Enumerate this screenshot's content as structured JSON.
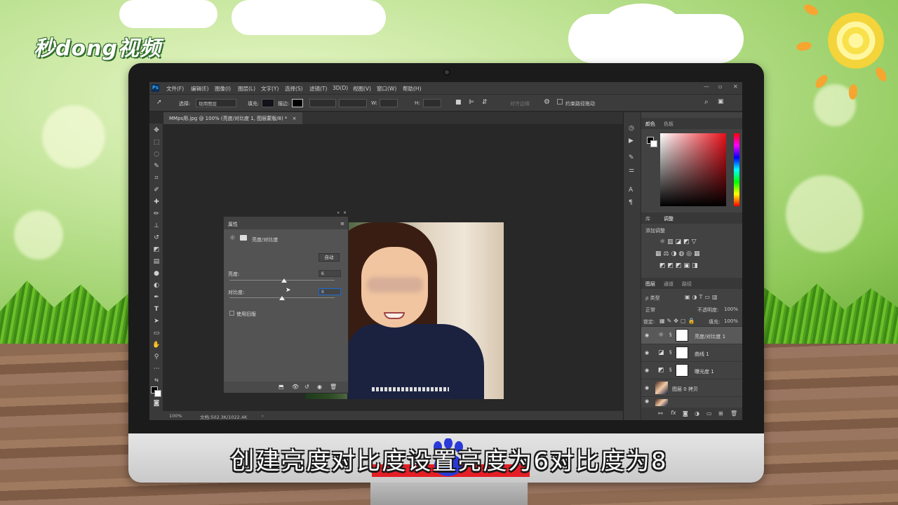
{
  "brand": {
    "logo_text": "秒dong视频"
  },
  "subtitle": "创建亮度对比度设置亮度为6对比度为8",
  "photoshop": {
    "app_icon": "Ps",
    "menu": [
      "文件(F)",
      "编辑(E)",
      "图像(I)",
      "图层(L)",
      "文字(Y)",
      "选择(S)",
      "滤镜(T)",
      "3D(D)",
      "视图(V)",
      "窗口(W)",
      "帮助(H)"
    ],
    "window_controls": [
      "—",
      "▫",
      "✕"
    ],
    "options_bar": {
      "select_label": "选择:",
      "select_value": "现用图层",
      "fill_label": "填充:",
      "stroke_label": "描边:",
      "w_label": "W:",
      "h_label": "H:",
      "align_edges": "对齐边缘",
      "constrain_path": "约束路径拖动"
    },
    "document_tab": "MMps用.jpg @ 100% (亮度/对比度 1, 图层蒙版/8) *",
    "status": {
      "zoom": "100%",
      "doc_info": "文档:502.3K/1022.4K"
    },
    "properties_panel": {
      "title": "属性",
      "type_label": "亮度/对比度",
      "auto_button": "自动",
      "brightness_label": "亮度:",
      "brightness_value": "6",
      "contrast_label": "对比度:",
      "contrast_value": "8",
      "legacy_label": "使用旧版"
    },
    "color_panel": {
      "tabs": [
        "颜色",
        "色板"
      ]
    },
    "adjustments_panel": {
      "tabs": [
        "库",
        "调整"
      ],
      "add_label": "添加调整"
    },
    "layers_panel": {
      "tabs": [
        "图层",
        "通道",
        "路径"
      ],
      "filter_label": "ρ 类型",
      "blend_mode": "正常",
      "opacity_label": "不透明度:",
      "opacity_value": "100%",
      "lock_label": "锁定:",
      "fill_label": "填充:",
      "fill_value": "100%",
      "layers": [
        {
          "name": "亮度/对比度 1",
          "active": true
        },
        {
          "name": "曲线 1",
          "active": false
        },
        {
          "name": "曝光度 1",
          "active": false
        },
        {
          "name": "图层 0 拷贝",
          "active": false
        }
      ]
    }
  }
}
